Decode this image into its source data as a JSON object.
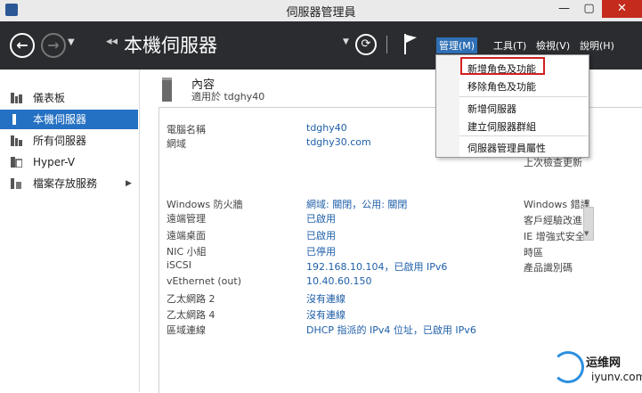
{
  "window": {
    "title": "伺服器管理員",
    "min": "—",
    "max": "▢",
    "close": "✕"
  },
  "header": {
    "title": "本機伺服器",
    "breadcrumb_arrows": "◂◂",
    "menus": {
      "manage": "管理(M)",
      "tools": "工具(T)",
      "view": "檢視(V)",
      "help": "說明(H)"
    }
  },
  "sidebar": {
    "items": [
      {
        "label": "儀表板",
        "icon": "dashboard-icon"
      },
      {
        "label": "本機伺服器",
        "icon": "local-server-icon"
      },
      {
        "label": "所有伺服器",
        "icon": "all-servers-icon"
      },
      {
        "label": "Hyper-V",
        "icon": "hyperv-icon"
      },
      {
        "label": "檔案存放服務",
        "icon": "file-storage-icon"
      }
    ]
  },
  "properties": {
    "title": "內容",
    "subtitle": "適用於 tdghy40"
  },
  "details": [
    {
      "label": "電腦名稱",
      "value": "tdghy40"
    },
    {
      "label": "網域",
      "value": "tdghy30.com"
    },
    {
      "label": "Windows 防火牆",
      "value": "網域: 關閉，公用: 關閉"
    },
    {
      "label": "遠端管理",
      "value": "已啟用"
    },
    {
      "label": "遠端桌面",
      "value": "已啟用"
    },
    {
      "label": "NIC 小組",
      "value": "已停用"
    },
    {
      "label": "iSCSI",
      "value": "192.168.10.104，已啟用 IPv6"
    },
    {
      "label": "vEthernet (out)",
      "value": "10.40.60.150"
    },
    {
      "label": "乙太網路 2",
      "value": "沒有連線"
    },
    {
      "label": "乙太網路 4",
      "value": "沒有連線"
    },
    {
      "label": "區域連線",
      "value": "DHCP 指派的 IPv4 位址，已啟用 IPv6"
    }
  ],
  "right_labels": [
    "上次檢查更新",
    "Windows 錯誤",
    "客戶經驗改進",
    "IE 增強式安全",
    "時區",
    "產品識別碼"
  ],
  "dropdown": {
    "items": [
      "新增角色及功能",
      "移除角色及功能",
      "新增伺服器",
      "建立伺服器群組",
      "伺服器管理員屬性"
    ]
  },
  "watermark": {
    "text": "运维网",
    "url": "iyunv.com"
  },
  "colors": {
    "accent": "#2470c2",
    "header_bg": "#2a2c30",
    "link": "#1f5fa8",
    "highlight": "#d12020"
  }
}
